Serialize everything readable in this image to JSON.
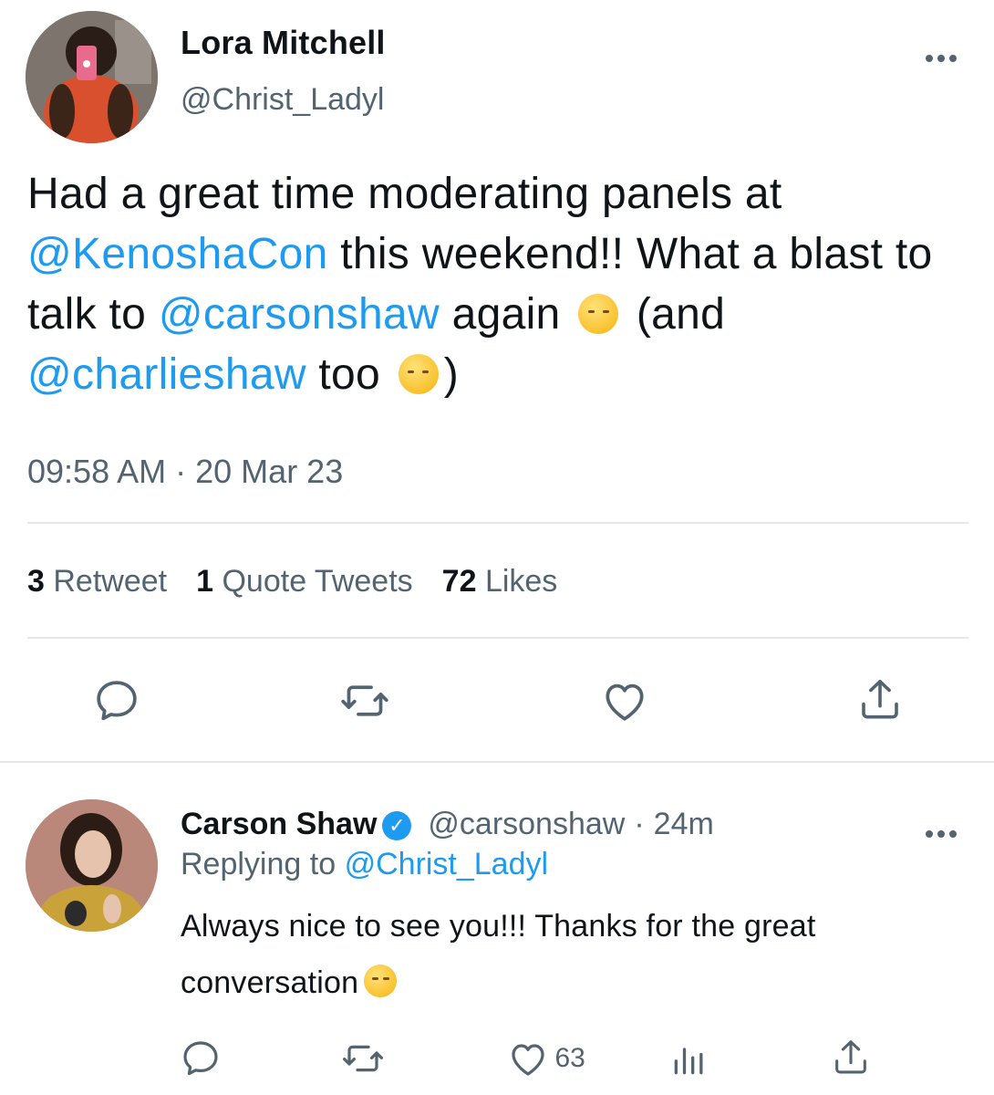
{
  "tweet": {
    "author_name": "Lora Mitchell",
    "author_handle": "@Christ_Ladyl",
    "more_label": "•••",
    "text_parts": {
      "p1": "Had a great time moderating panels at ",
      "m1": "@KenoshaCon",
      "p2": " this weekend!! What a blast to talk to ",
      "m2": "@carsonshaw",
      "p3": " again ",
      "p4": " (and ",
      "m3": "@charlieshaw",
      "p5": " too ",
      "p6": ")"
    },
    "time": "09:58 AM",
    "separator": "·",
    "date": "20 Mar 23",
    "stats": {
      "retweets": "3",
      "retweets_label": "Retweet",
      "quotes": "1",
      "quotes_label": "Quote Tweets",
      "likes": "72",
      "likes_label": "Likes"
    },
    "actions": [
      "reply-icon",
      "retweet-icon",
      "like-icon",
      "share-icon"
    ]
  },
  "reply": {
    "author_name": "Carson Shaw",
    "verified": true,
    "author_handle": "@carsonshaw",
    "separator": "·",
    "time_ago": "24m",
    "more_label": "•••",
    "replying_prefix": "Replying to",
    "replying_handle": "@Christ_Ladyl",
    "text": "Always nice to see you!!! Thanks for the great conversation",
    "like_count": "63",
    "actions": [
      "reply-icon",
      "retweet-icon",
      "like-icon",
      "analytics-icon",
      "share-icon"
    ]
  },
  "colors": {
    "accent": "#1d9bf0",
    "text": "#0f1419",
    "muted": "#536471",
    "divider": "#e6e9ec"
  }
}
